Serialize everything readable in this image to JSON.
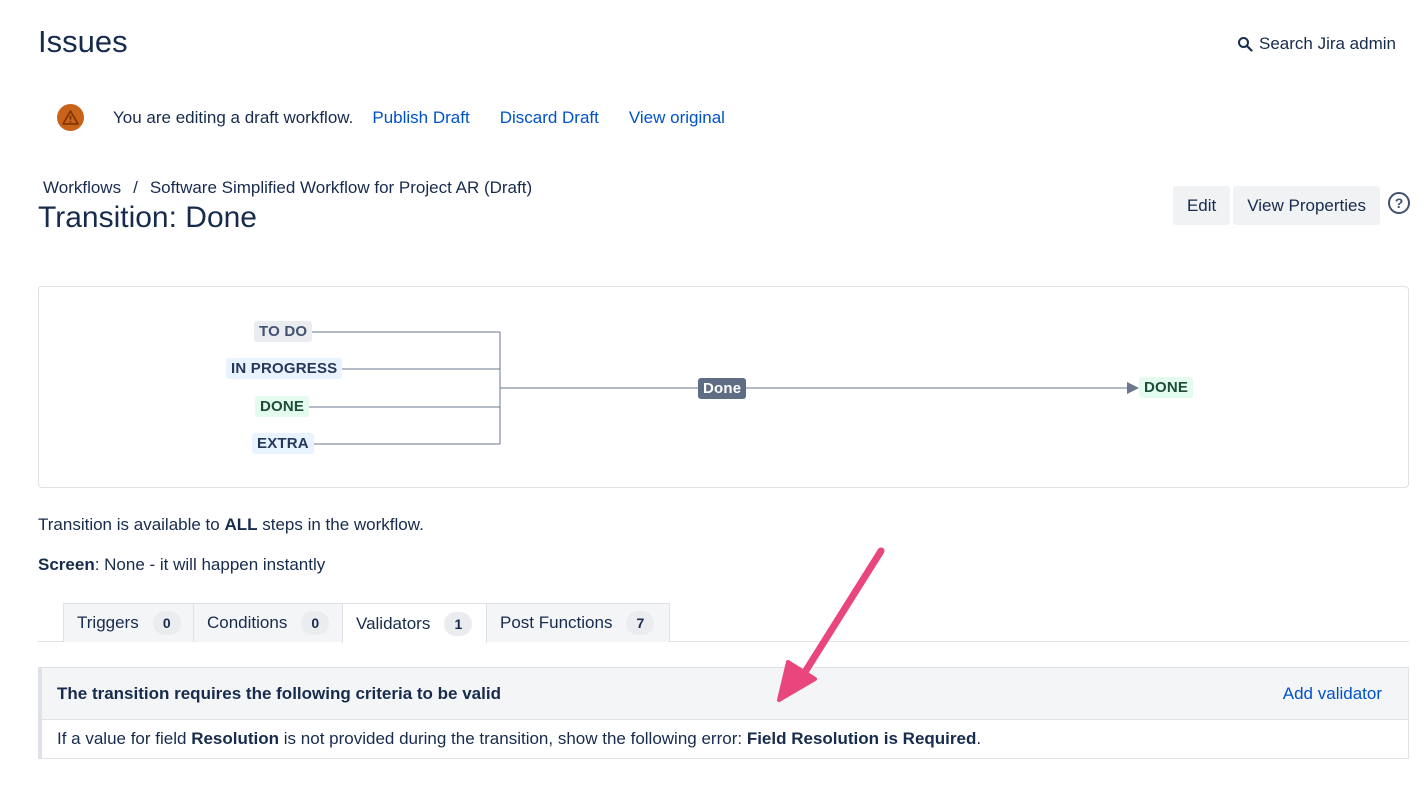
{
  "header": {
    "title": "Issues",
    "search_label": "Search Jira admin"
  },
  "draft_bar": {
    "message": "You are editing a draft workflow.",
    "publish": "Publish Draft",
    "discard": "Discard Draft",
    "view_original": "View original"
  },
  "breadcrumb": {
    "root": "Workflows",
    "separator": "/",
    "current": "Software Simplified Workflow for Project AR (Draft)"
  },
  "transition_title": "Transition: Done",
  "actions": {
    "edit": "Edit",
    "view_properties": "View Properties",
    "help": "?"
  },
  "diagram": {
    "source_statuses": [
      {
        "label": "TO DO",
        "category": "grey"
      },
      {
        "label": "IN PROGRESS",
        "category": "blue"
      },
      {
        "label": "DONE",
        "category": "green"
      },
      {
        "label": "EXTRA",
        "category": "blue"
      }
    ],
    "transition_label": "Done",
    "target_status": "DONE"
  },
  "info": {
    "availability_prefix": "Transition is available to ",
    "availability_strong": "ALL",
    "availability_suffix": " steps in the workflow.",
    "screen_label": "Screen",
    "screen_value": ": None - it will happen instantly"
  },
  "tabs": [
    {
      "label": "Triggers",
      "count": "0",
      "active": false
    },
    {
      "label": "Conditions",
      "count": "0",
      "active": false
    },
    {
      "label": "Validators",
      "count": "1",
      "active": true
    },
    {
      "label": "Post Functions",
      "count": "7",
      "active": false
    }
  ],
  "validators": {
    "heading": "The transition requires the following criteria to be valid",
    "add_label": "Add validator",
    "row": {
      "p1": "If a value for field ",
      "field": "Resolution",
      "p2": " is not provided during the transition, show the following error: ",
      "error": "Field Resolution is Required",
      "p3": "."
    }
  },
  "colors": {
    "link": "#0052cc",
    "warning": "#c9631a",
    "annotation_arrow": "#e8467c"
  }
}
